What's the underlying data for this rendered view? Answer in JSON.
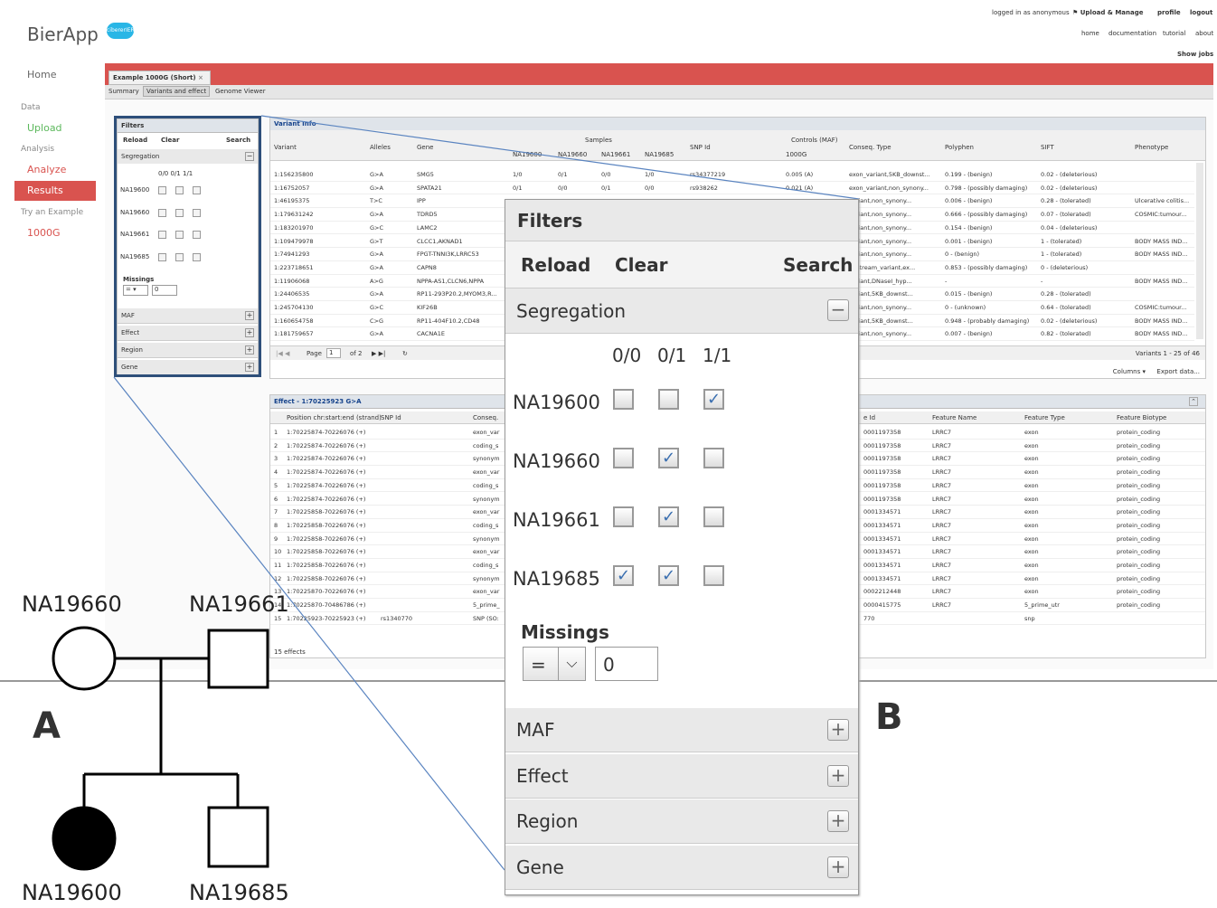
{
  "header": {
    "logo_text": "BierApp",
    "logo_badge": "cibererIER",
    "logged_in": "logged in as anonymous",
    "upload_manage": "Upload & Manage",
    "profile": "profile",
    "logout": "logout",
    "home": "home",
    "documentation": "documentation",
    "tutorial": "tutorial",
    "about": "about",
    "show_jobs": "Show jobs"
  },
  "sidebar": {
    "home": "Home",
    "data": "Data",
    "upload": "Upload",
    "analysis": "Analysis",
    "analyze": "Analyze",
    "results": "Results",
    "try": "Try an Example",
    "example": "1000G"
  },
  "tabs": {
    "main_tab": "Example 1000G (Short)",
    "summary": "Summary",
    "variants": "Variants and effect",
    "genome": "Genome Viewer"
  },
  "filters": {
    "title": "Filters",
    "reload": "Reload",
    "clear": "Clear",
    "search": "Search",
    "segregation": "Segregation",
    "geno_headers": [
      "0/0",
      "0/1",
      "1/1"
    ],
    "samples": [
      {
        "name": "NA19600",
        "checks": [
          false,
          false,
          true
        ]
      },
      {
        "name": "NA19660",
        "checks": [
          false,
          true,
          false
        ]
      },
      {
        "name": "NA19661",
        "checks": [
          false,
          true,
          false
        ]
      },
      {
        "name": "NA19685",
        "checks": [
          true,
          true,
          false
        ]
      }
    ],
    "missings": "Missings",
    "missings_op": "=",
    "missings_value": "0",
    "sections": [
      "MAF",
      "Effect",
      "Region",
      "Gene"
    ]
  },
  "variants": {
    "title": "Variant Info",
    "col_variant": "Variant",
    "col_alleles": "Alleles",
    "col_gene": "Gene",
    "col_samples": "Samples",
    "sample_cols": [
      "NA19600",
      "NA19660",
      "NA19661",
      "NA19685"
    ],
    "col_snp": "SNP Id",
    "col_controls": "Controls (MAF)",
    "col_1000g": "1000G",
    "col_conseq": "Conseq. Type",
    "col_polyphen": "Polyphen",
    "col_sift": "SIFT",
    "col_phenotype": "Phenotype",
    "rows": [
      [
        "1:156235800",
        "G>A",
        "SMG5",
        "1/0",
        "0/1",
        "0/0",
        "1/0",
        "rs34377219",
        "0.005 (A)",
        "exon_variant,5KB_downst...",
        "0.199 - (benign)",
        "0.02 - (deleterious)",
        ""
      ],
      [
        "1:16752057",
        "G>A",
        "SPATA21",
        "0/1",
        "0/0",
        "0/1",
        "0/0",
        "rs938262",
        "0.021 (A)",
        "exon_variant,non_synony...",
        "0.798 - (possibly damaging)",
        "0.02 - (deleterious)",
        ""
      ],
      [
        "1:46195375",
        "T>C",
        "IPP",
        "",
        "",
        "",
        "",
        "",
        "",
        "variant,non_synony...",
        "0.006 - (benign)",
        "0.28 - (tolerated)",
        "Ulcerative colitis..."
      ],
      [
        "1:179631242",
        "G>A",
        "TDRD5",
        "",
        "",
        "",
        "",
        "",
        "",
        "variant,non_synony...",
        "0.666 - (possibly damaging)",
        "0.07 - (tolerated)",
        "COSMIC:tumour..."
      ],
      [
        "1:183201970",
        "G>C",
        "LAMC2",
        "",
        "",
        "",
        "",
        "",
        "",
        "variant,non_synony...",
        "0.154 - (benign)",
        "0.04 - (deleterious)",
        ""
      ],
      [
        "1:109479978",
        "G>T",
        "CLCC1,AKNAD1",
        "",
        "",
        "",
        "",
        "",
        "",
        "variant,non_synony...",
        "0.001 - (benign)",
        "1 - (tolerated)",
        "BODY MASS IND..."
      ],
      [
        "1:74941293",
        "G>A",
        "FPGT-TNNI3K,LRRC53",
        "",
        "",
        "",
        "",
        "",
        "",
        "variant,non_synony...",
        "0 - (benign)",
        "1 - (tolerated)",
        "BODY MASS IND..."
      ],
      [
        "1:223718651",
        "G>A",
        "CAPN8",
        "",
        "",
        "",
        "",
        "",
        "",
        "upstream_variant,ex...",
        "0.853 - (possibly damaging)",
        "0 - (deleterious)",
        ""
      ],
      [
        "1:11906068",
        "A>G",
        "NPPA-AS1,CLCN6,NPPA",
        "",
        "",
        "",
        "",
        "",
        "",
        "variant,DNaseI_hyp...",
        "-",
        "-",
        "BODY MASS IND..."
      ],
      [
        "1:24406535",
        "G>A",
        "RP11-293P20.2,MYOM3,R...",
        "",
        "",
        "",
        "",
        "",
        "",
        "variant,5KB_downst...",
        "0.015 - (benign)",
        "0.28 - (tolerated)",
        ""
      ],
      [
        "1:245704130",
        "G>C",
        "KIF26B",
        "",
        "",
        "",
        "",
        "",
        "",
        "variant,non_synony...",
        "0 - (unknown)",
        "0.64 - (tolerated)",
        "COSMIC:tumour..."
      ],
      [
        "1:160654758",
        "C>G",
        "RP11-404F10.2,CD48",
        "",
        "",
        "",
        "",
        "",
        "",
        "variant,5KB_downst...",
        "0.948 - (probably damaging)",
        "0.02 - (deleterious)",
        "BODY MASS IND..."
      ],
      [
        "1:181759657",
        "G>A",
        "CACNA1E",
        "",
        "",
        "",
        "",
        "",
        "",
        "variant,non_synony...",
        "0.007 - (benign)",
        "0.82 - (tolerated)",
        "BODY MASS IND..."
      ]
    ],
    "page_label": "Page",
    "page_value": "1",
    "page_of": "of 2",
    "count": "Variants 1 - 25 of 46",
    "columns": "Columns",
    "export": "Export data..."
  },
  "effects": {
    "title": "Effect - 1:70225923 G>A",
    "col_position": "Position chr:start:end (strand)",
    "col_snp": "SNP Id",
    "col_conseq": "Conseq.",
    "col_id": "e Id",
    "col_feature_name": "Feature Name",
    "col_feature_type": "Feature Type",
    "col_biotype": "Feature Biotype",
    "rows": [
      [
        "1",
        "1:70225874-70226076 (+)",
        "",
        "exon_var",
        "0001197358",
        "LRRC7",
        "exon",
        "protein_coding"
      ],
      [
        "2",
        "1:70225874-70226076 (+)",
        "",
        "coding_s",
        "0001197358",
        "LRRC7",
        "exon",
        "protein_coding"
      ],
      [
        "3",
        "1:70225874-70226076 (+)",
        "",
        "synonym",
        "0001197358",
        "LRRC7",
        "exon",
        "protein_coding"
      ],
      [
        "4",
        "1:70225874-70226076 (+)",
        "",
        "exon_var",
        "0001197358",
        "LRRC7",
        "exon",
        "protein_coding"
      ],
      [
        "5",
        "1:70225874-70226076 (+)",
        "",
        "coding_s",
        "0001197358",
        "LRRC7",
        "exon",
        "protein_coding"
      ],
      [
        "6",
        "1:70225874-70226076 (+)",
        "",
        "synonym",
        "0001197358",
        "LRRC7",
        "exon",
        "protein_coding"
      ],
      [
        "7",
        "1:70225858-70226076 (+)",
        "",
        "exon_var",
        "0001334571",
        "LRRC7",
        "exon",
        "protein_coding"
      ],
      [
        "8",
        "1:70225858-70226076 (+)",
        "",
        "coding_s",
        "0001334571",
        "LRRC7",
        "exon",
        "protein_coding"
      ],
      [
        "9",
        "1:70225858-70226076 (+)",
        "",
        "synonym",
        "0001334571",
        "LRRC7",
        "exon",
        "protein_coding"
      ],
      [
        "10",
        "1:70225858-70226076 (+)",
        "",
        "exon_var",
        "0001334571",
        "LRRC7",
        "exon",
        "protein_coding"
      ],
      [
        "11",
        "1:70225858-70226076 (+)",
        "",
        "coding_s",
        "0001334571",
        "LRRC7",
        "exon",
        "protein_coding"
      ],
      [
        "12",
        "1:70225858-70226076 (+)",
        "",
        "synonym",
        "0001334571",
        "LRRC7",
        "exon",
        "protein_coding"
      ],
      [
        "13",
        "1:70225870-70226076 (+)",
        "",
        "exon_var",
        "0002212448",
        "LRRC7",
        "exon",
        "protein_coding"
      ],
      [
        "14",
        "1:70225870-70486786 (+)",
        "",
        "5_prime_",
        "0000415775",
        "LRRC7",
        "5_prime_utr",
        "protein_coding"
      ],
      [
        "15",
        "1:70225923-70225923 (+)",
        "rs1340770",
        "SNP (SO:",
        "770",
        "",
        "snp",
        ""
      ]
    ],
    "footer": "15 effects"
  },
  "pedigree": {
    "father": "NA19660",
    "mother": "NA19661",
    "child_affected": "NA19600",
    "child_unaffected": "NA19685"
  },
  "labels": {
    "a": "A",
    "b": "B"
  },
  "colors": {
    "accent_red": "#d9534f",
    "link_blue": "#15428b",
    "zoom_frame": "#2e4f7a"
  }
}
